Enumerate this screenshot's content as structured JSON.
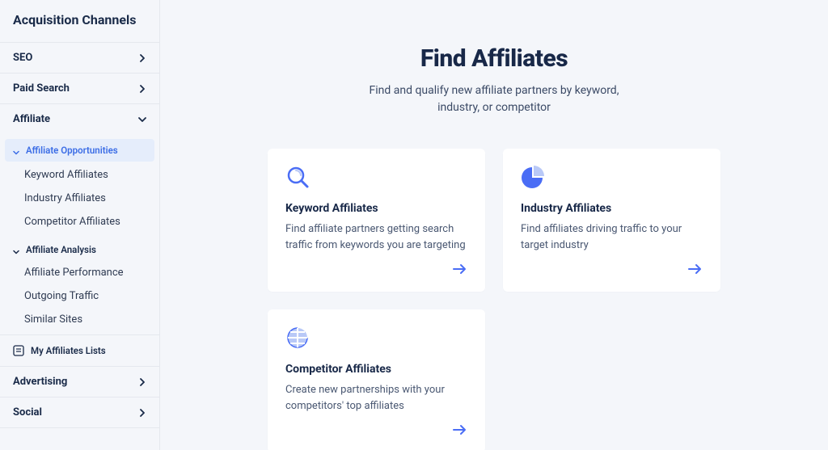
{
  "sidebar": {
    "title": "Acquisition Channels",
    "items": [
      {
        "label": "SEO"
      },
      {
        "label": "Paid Search"
      },
      {
        "label": "Affiliate"
      },
      {
        "label": "Advertising"
      },
      {
        "label": "Social"
      }
    ],
    "affiliate": {
      "opportunities": {
        "header": "Affiliate Opportunities",
        "items": [
          {
            "label": "Keyword Affiliates"
          },
          {
            "label": "Industry Affiliates"
          },
          {
            "label": "Competitor Affiliates"
          }
        ]
      },
      "analysis": {
        "header": "Affiliate Analysis",
        "items": [
          {
            "label": "Affiliate Performance"
          },
          {
            "label": "Outgoing Traffic"
          },
          {
            "label": "Similar Sites"
          }
        ]
      },
      "my_lists": "My Affiliates Lists"
    }
  },
  "main": {
    "title": "Find Affiliates",
    "subtitle": "Find and qualify new affiliate partners by keyword, industry, or competitor",
    "cards": [
      {
        "title": "Keyword Affiliates",
        "desc": "Find affiliate partners getting search traffic from keywords you are targeting"
      },
      {
        "title": "Industry Affiliates",
        "desc": "Find affiliates driving traffic to your target industry"
      },
      {
        "title": "Competitor Affiliates",
        "desc": "Create new partnerships with your competitors' top affiliates"
      }
    ]
  }
}
